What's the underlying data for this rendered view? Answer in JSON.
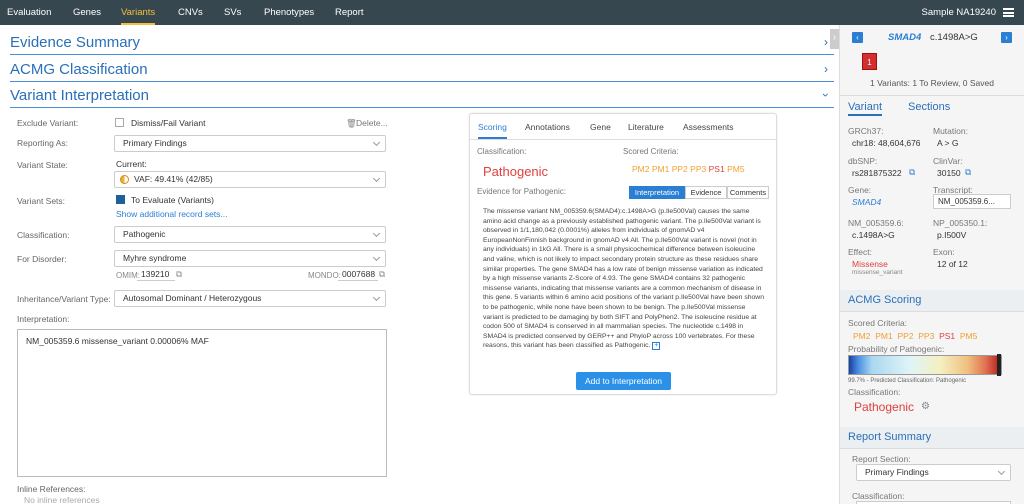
{
  "nav": {
    "tabs": [
      "Evaluation",
      "Genes",
      "Variants",
      "CNVs",
      "SVs",
      "Phenotypes",
      "Report"
    ],
    "active": "Variants",
    "sample": "Sample NA19240"
  },
  "sections": {
    "evidence": "Evidence Summary",
    "acmg": "ACMG Classification",
    "interp": "Variant Interpretation"
  },
  "form": {
    "exclude_label": "Exclude Variant:",
    "exclude_value": "Dismiss/Fail Variant",
    "delete": "Delete...",
    "reporting_label": "Reporting As:",
    "reporting_value": "Primary Findings",
    "state_label": "Variant State:",
    "state_current": "Current:",
    "state_value": "VAF: 49.41% (42/85)",
    "sets_label": "Variant Sets:",
    "sets_value": "To Evaluate (Variants)",
    "sets_link": "Show additional record sets...",
    "class_label": "Classification:",
    "class_value": "Pathogenic",
    "disorder_label": "For Disorder:",
    "disorder_value": "Myhre syndrome",
    "omim_label": "OMIM:",
    "omim_value": "139210",
    "mondo_label": "MONDO:",
    "mondo_value": "0007688",
    "inherit_label": "Inheritance/Variant Type:",
    "inherit_value": "Autosomal Dominant / Heterozygous",
    "interp_label": "Interpretation:",
    "interp_value": "NM_005359.6 missense_variant 0.00006% MAF",
    "inline_label": "Inline References:",
    "inline_value": "No inline references"
  },
  "panel": {
    "tabs": [
      "Scoring",
      "Annotations",
      "Gene",
      "Literature",
      "Assessments"
    ],
    "classification_label": "Classification:",
    "classification_value": "Pathogenic",
    "scored_label": "Scored Criteria:",
    "criteria": [
      "PM2",
      "PM1",
      "PP2",
      "PP3",
      "PS1",
      "PM5"
    ],
    "evidence_label": "Evidence for Pathogenic:",
    "subtabs": [
      "Interpretation",
      "Evidence",
      "Comments"
    ],
    "body": "The missense variant NM_005359.6(SMAD4):c.1498A>G (p.Ile500Val) causes the same amino acid change as a previously established pathogenic variant. The p.Ile500Val variant is observed in 1/1,180,042 (0.0001%) alleles from individuals of gnomAD v4 EuropeanNonFinnish background in gnomAD v4 All. The p.Ile500Val variant is novel (not in any individuals) in 1kG All. There is a small physicochemical difference between isoleucine and valine, which is not likely to impact secondary protein structure as these residues share similar properties. The gene SMAD4 has a low rate of benign missense variation as indicated by a high missense variants Z-Score of 4.93. The gene SMAD4 contains 32 pathogenic missense variants, indicating that missense variants are a common mechanism of disease in this gene. 5 variants within 6 amino acid positions of the variant p.Ile500Val have been shown to be pathogenic, while none have been shown to be benign. The p.Ile500Val missense variant is predicted to be damaging by both SIFT and PolyPhen2. The isoleucine residue at codon 500 of SMAD4 is conserved in all mammalian species. The nucleotide c.1498 in SMAD4 is predicted conserved by GERP++ and PhyloP across 100 vertebrates. For these reasons, this variant has been classified as Pathogenic.",
    "add_button": "Add to Interpretation"
  },
  "right": {
    "gene": "SMAD4",
    "variant": "c.1498A>G",
    "count": "1",
    "summary": "1 Variants: 1 To Review, 0 Saved",
    "tab_variant": "Variant",
    "tab_sections": "Sections",
    "grch_label": "GRCh37:",
    "grch_value": "chr18: 48,604,676",
    "mut_label": "Mutation:",
    "mut_value": "A > G",
    "dbsnp_label": "dbSNP:",
    "dbsnp_value": "rs281875322",
    "clinvar_label": "ClinVar:",
    "clinvar_value": "30150",
    "gene_label": "Gene:",
    "gene_value": "SMAD4",
    "transcript_label": "Transcript:",
    "transcript_value": "NM_005359.6...",
    "nm_label": "NM_005359.6:",
    "nm_value": "c.1498A>G",
    "np_label": "NP_005350.1:",
    "np_value": "p.I500V",
    "effect_label": "Effect:",
    "effect_value": "Missense",
    "effect_sub": "missense_variant",
    "exon_label": "Exon:",
    "exon_value": "12 of 12",
    "acmg_title": "ACMG Scoring",
    "scored_label": "Scored Criteria:",
    "criteria": [
      "PM2",
      "PM1",
      "PP2",
      "PP3",
      "PS1",
      "PM5"
    ],
    "prob_label": "Probability of Pathogenic:",
    "prob_value": 0.997,
    "prob_text": "99.7% - Predicted Classification: Pathogenic",
    "class_label": "Classification:",
    "class_value": "Pathogenic",
    "report_title": "Report Summary",
    "report_label": "Report Section:",
    "report_value": "Primary Findings",
    "report_class_label": "Classification:"
  },
  "colors": {
    "nav_bg": "#37474f",
    "accent": "#2a7fd4",
    "pathogenic": "#e04040",
    "criteria_orange": "#f0a030",
    "criteria_red": "#e04040"
  }
}
